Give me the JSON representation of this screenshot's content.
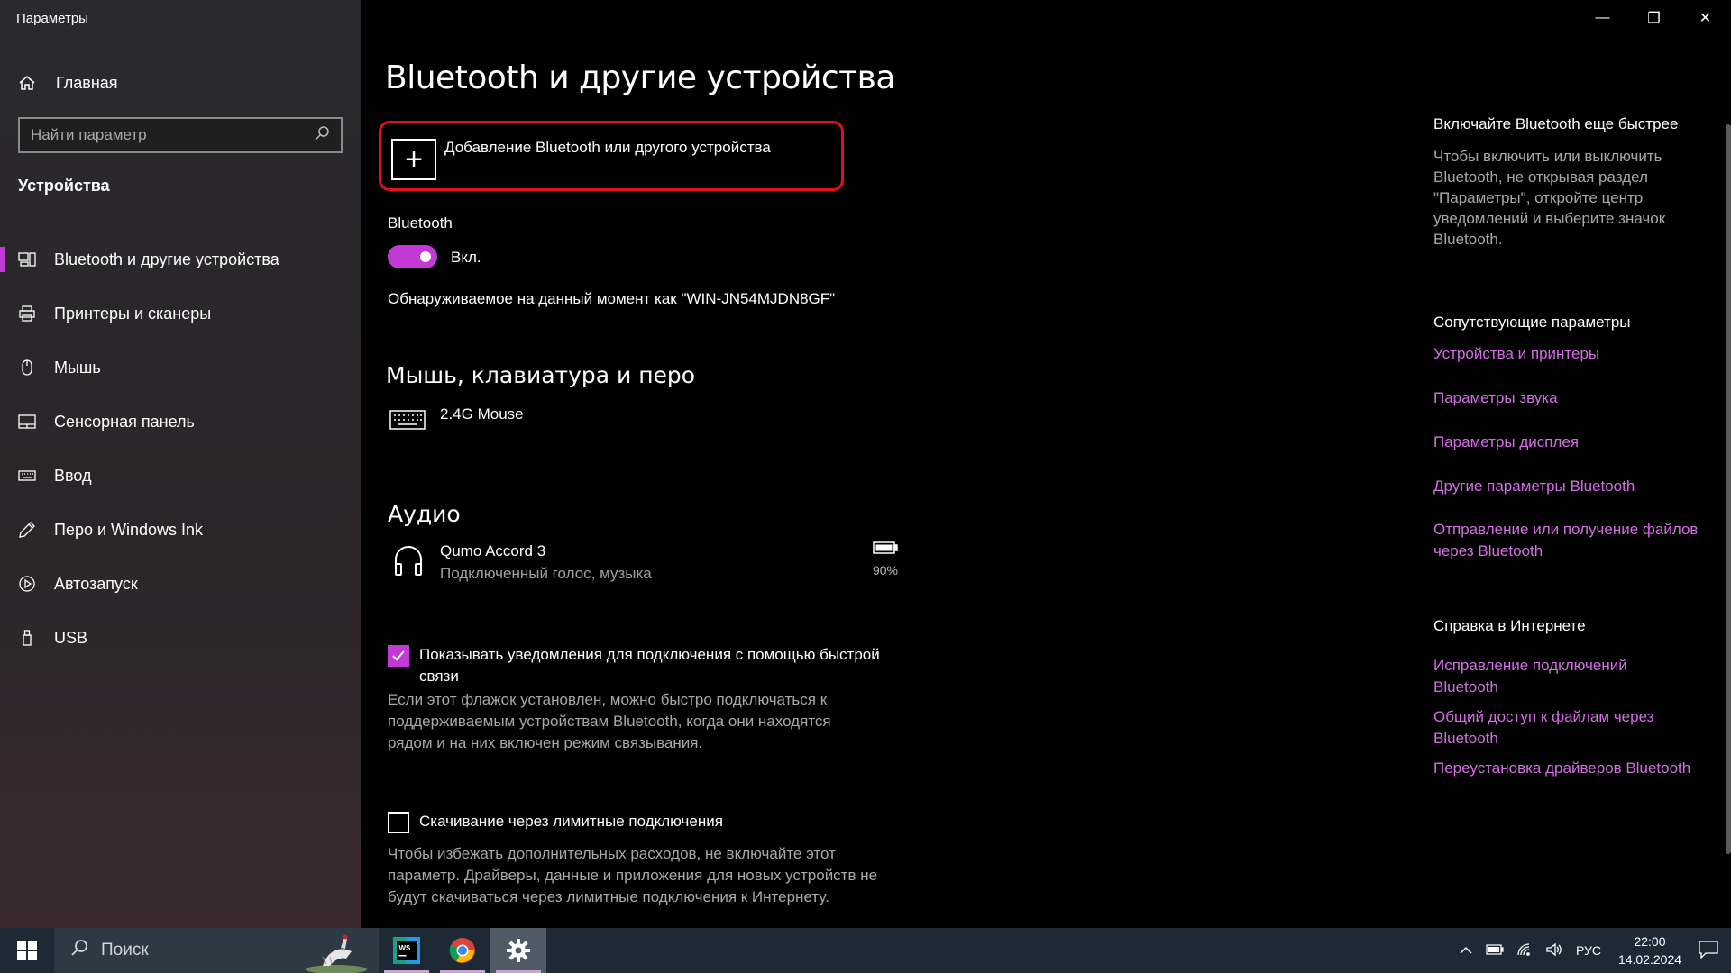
{
  "window": {
    "title": "Параметры",
    "minimize": "—",
    "maximize": "❐",
    "close": "✕"
  },
  "sidebar": {
    "home_label": "Главная",
    "search_placeholder": "Найти параметр",
    "section_label": "Устройства",
    "items": [
      {
        "label": "Bluetooth и другие устройства",
        "icon": "bluetooth-devices-icon",
        "active": true
      },
      {
        "label": "Принтеры и сканеры",
        "icon": "printer-icon",
        "active": false
      },
      {
        "label": "Мышь",
        "icon": "mouse-icon",
        "active": false
      },
      {
        "label": "Сенсорная панель",
        "icon": "touchpad-icon",
        "active": false
      },
      {
        "label": "Ввод",
        "icon": "keyboard-icon",
        "active": false
      },
      {
        "label": "Перо и Windows Ink",
        "icon": "pen-icon",
        "active": false
      },
      {
        "label": "Автозапуск",
        "icon": "autoplay-icon",
        "active": false
      },
      {
        "label": "USB",
        "icon": "usb-icon",
        "active": false
      }
    ]
  },
  "main": {
    "title": "Bluetooth и другие устройства",
    "add_device_label": "Добавление Bluetooth или другого устройства",
    "bluetooth_label": "Bluetooth",
    "bluetooth_state": "Вкл.",
    "discoverable_text": "Обнаруживаемое на данный момент как \"WIN-JN54MJDN8GF\"",
    "input_section": {
      "title": "Мышь, клавиатура и перо",
      "device_name": "2.4G Mouse"
    },
    "audio_section": {
      "title": "Аудио",
      "device_name": "Qumo Accord 3",
      "device_status": "Подключенный голос, музыка",
      "battery": "90%"
    },
    "swift_pair": {
      "checked": true,
      "label_line1": "Показывать уведомления для подключения с помощью быстрой",
      "label_line2": "связи",
      "desc_lines": [
        "Если этот флажок установлен, можно быстро подключаться к",
        "поддерживаемым устройствам Bluetooth, когда они находятся",
        "рядом и на них включен режим связывания."
      ]
    },
    "metered": {
      "checked": false,
      "label": "Скачивание через лимитные подключения",
      "desc_lines": [
        "Чтобы избежать дополнительных расходов, не включайте этот",
        "параметр. Драйверы, данные и приложения для новых устройств не",
        "будут скачиваться через лимитные подключения к Интернету."
      ]
    }
  },
  "right_panel": {
    "tip_title": "Включайте Bluetooth еще быстрее",
    "tip_lines": [
      "Чтобы включить или выключить",
      "Bluetooth, не открывая раздел",
      "\"Параметры\", откройте центр",
      "уведомлений и выберите значок",
      "Bluetooth."
    ],
    "related_title": "Сопутствующие параметры",
    "related_links": [
      "Устройства и принтеры",
      "Параметры звука",
      "Параметры дисплея",
      "Другие параметры Bluetooth",
      "Отправление или получение файлов",
      "через Bluetooth"
    ],
    "help_title": "Справка в Интернете",
    "help_links": [
      "Исправление подключений",
      "Bluetooth",
      "Общий доступ к файлам через",
      "Bluetooth",
      "Переустановка драйверов Bluetooth"
    ]
  },
  "taskbar": {
    "search_label": "Поиск",
    "language": "РУС",
    "time": "22:00",
    "date": "14.02.2024",
    "apps": [
      "webstorm-icon",
      "chrome-icon",
      "settings-gear-icon"
    ]
  },
  "colors": {
    "accent": "#c239d6",
    "link": "#d36ee3",
    "highlight_border": "#e0101e"
  }
}
